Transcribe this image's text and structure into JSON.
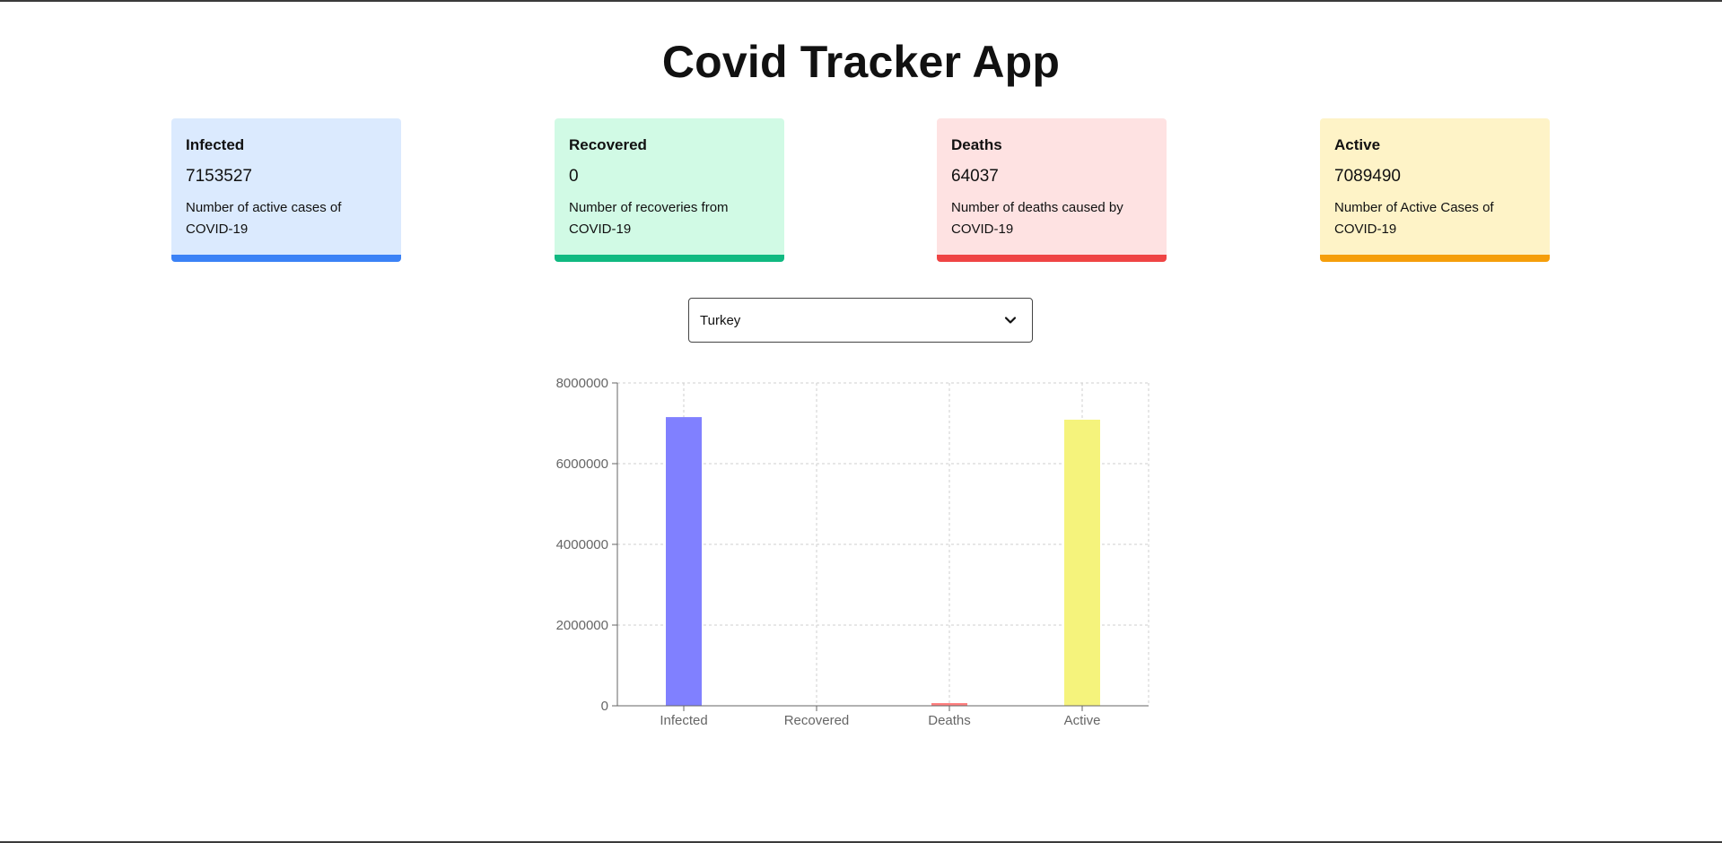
{
  "app": {
    "title": "Covid Tracker App"
  },
  "cards": [
    {
      "title": "Infected",
      "value": "7153527",
      "description": "Number of active cases of COVID-19",
      "bg": "#dbeafe",
      "accent": "#3b82f6"
    },
    {
      "title": "Recovered",
      "value": "0",
      "description": "Number of recoveries from COVID-19",
      "bg": "#d1fae5",
      "accent": "#10b981"
    },
    {
      "title": "Deaths",
      "value": "64037",
      "description": "Number of deaths caused by COVID-19",
      "bg": "#fee2e2",
      "accent": "#ef4444"
    },
    {
      "title": "Active",
      "value": "7089490",
      "description": "Number of Active Cases of COVID-19",
      "bg": "#fef3c7",
      "accent": "#f59e0b"
    }
  ],
  "country_select": {
    "selected": "Turkey",
    "icon": "chevron-down-icon"
  },
  "chart_data": {
    "type": "bar",
    "categories": [
      "Infected",
      "Recovered",
      "Deaths",
      "Active"
    ],
    "values": [
      7153527,
      0,
      64037,
      7089490
    ],
    "colors": [
      "#8080ff",
      "#80ff80",
      "#ff8080",
      "#f5f37c"
    ],
    "y_ticks": [
      "0",
      "2000000",
      "4000000",
      "6000000",
      "8000000"
    ],
    "ylim": [
      0,
      8000000
    ],
    "grid": true,
    "title": "",
    "xlabel": "",
    "ylabel": ""
  }
}
